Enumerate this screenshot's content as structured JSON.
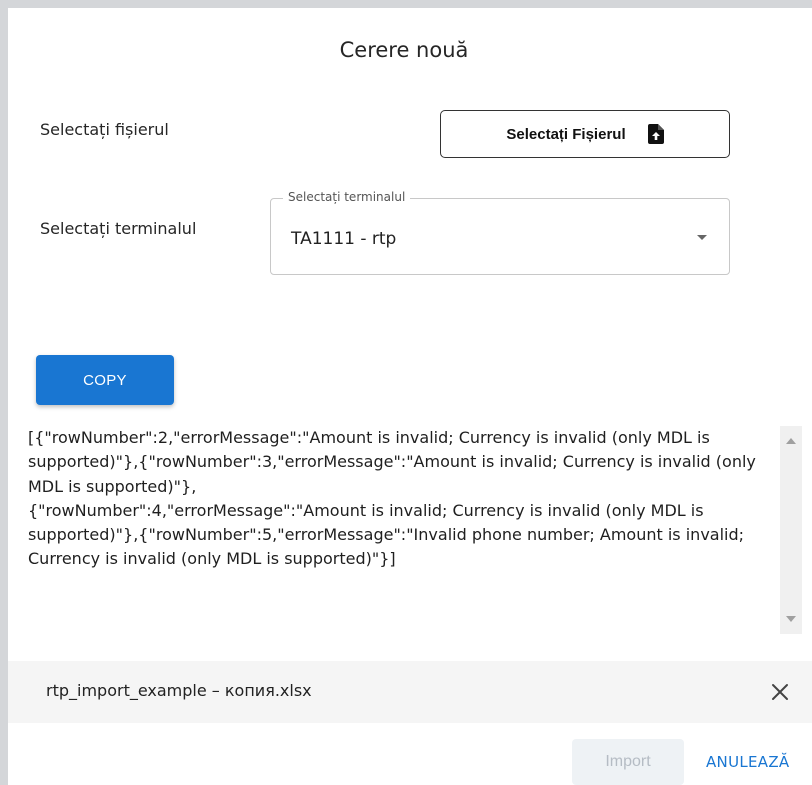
{
  "dialog": {
    "title": "Cerere nouă",
    "file_row": {
      "label": "Selectați fișierul",
      "button_label": "Selectați Fișierul",
      "button_icon": "file-upload-icon"
    },
    "terminal_row": {
      "label": "Selectați terminalul",
      "select_legend": "Selectați terminalul",
      "select_value": "TA1111 - rtp"
    },
    "copy_button": "COPY",
    "errors_text": "[{\"rowNumber\":2,\"errorMessage\":\"Amount is invalid; Currency is invalid (only MDL is supported)\"},{\"rowNumber\":3,\"errorMessage\":\"Amount is invalid; Currency is invalid (only MDL is supported)\"},\n{\"rowNumber\":4,\"errorMessage\":\"Amount is invalid; Currency is invalid (only MDL is supported)\"},{\"rowNumber\":5,\"errorMessage\":\"Invalid phone number; Amount is invalid; Currency is invalid (only MDL is supported)\"}]",
    "selected_file": "rtp_import_example – копия.xlsx",
    "import_button": "Import",
    "cancel_button": "ANULEAZĂ"
  },
  "colors": {
    "accent": "#1976d2",
    "disabled_bg": "#eef2f5",
    "disabled_text": "#b5bcc4",
    "page_bg": "#d4d6d9"
  }
}
